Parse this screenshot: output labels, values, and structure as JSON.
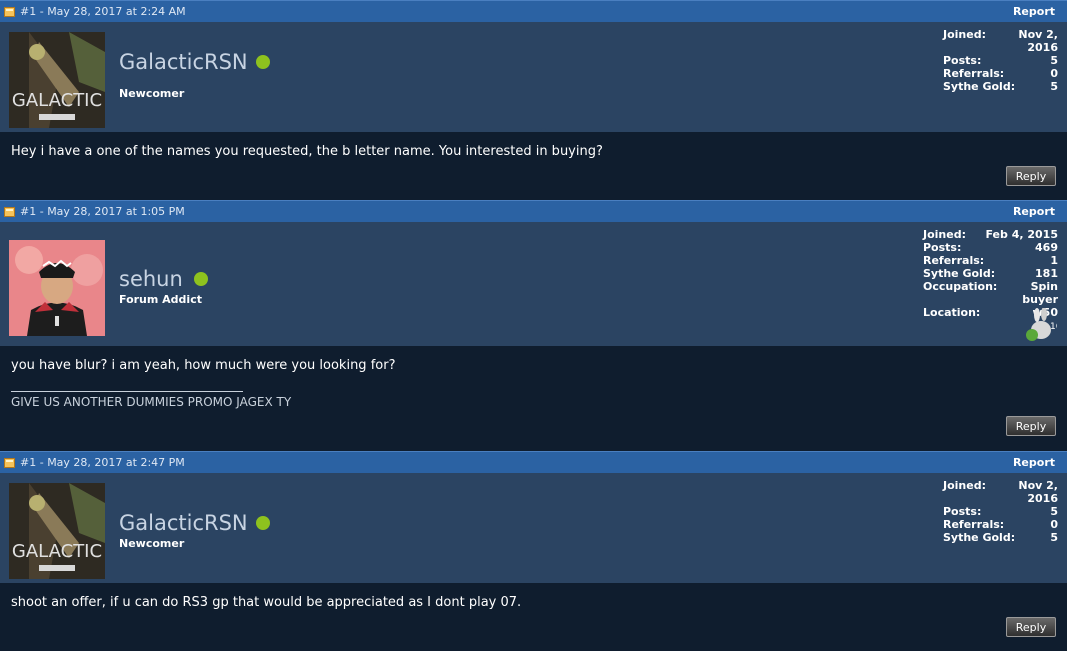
{
  "posts": [
    {
      "number": "#1",
      "date": "May 28, 2017 at 2:24 AM",
      "report": "Report",
      "username": "GalacticRSN",
      "user_title": "Newcomer",
      "avatar_text": "GALACTIC",
      "stats": [
        {
          "label": "Joined:",
          "value": "Nov 2, 2016"
        },
        {
          "label": "Posts:",
          "value": "5"
        },
        {
          "label": "Referrals:",
          "value": "0"
        },
        {
          "label": "Sythe Gold:",
          "value": "5"
        }
      ],
      "message": "Hey i have a one of the names you requested, the b letter name. You interested in buying?",
      "reply": "Reply"
    },
    {
      "number": "#1",
      "date": "May 28, 2017 at 1:05 PM",
      "report": "Report",
      "username": "sehun",
      "user_title": "Forum Addict",
      "stats": [
        {
          "label": "Joined:",
          "value": "Feb 4, 2015"
        },
        {
          "label": "Posts:",
          "value": "469"
        },
        {
          "label": "Referrals:",
          "value": "1"
        },
        {
          "label": "Sythe Gold:",
          "value": "181"
        },
        {
          "label": "Occupation:",
          "value": "Spin buyer"
        },
        {
          "label": "Location:",
          "value": "w50"
        }
      ],
      "badge_number": "16",
      "message": "you have blur? i am yeah, how much were you looking for?",
      "signature": "GIVE US ANOTHER DUMMIES PROMO JAGEX TY",
      "reply": "Reply"
    },
    {
      "number": "#1",
      "date": "May 28, 2017 at 2:47 PM",
      "report": "Report",
      "username": "GalacticRSN",
      "user_title": "Newcomer",
      "avatar_text": "GALACTIC",
      "stats": [
        {
          "label": "Joined:",
          "value": "Nov 2, 2016"
        },
        {
          "label": "Posts:",
          "value": "5"
        },
        {
          "label": "Referrals:",
          "value": "0"
        },
        {
          "label": "Sythe Gold:",
          "value": "5"
        }
      ],
      "message": "shoot an offer, if u can do RS3 gp that would be appreciated as I dont play 07.",
      "reply": "Reply"
    }
  ],
  "colors": {
    "header_bar": "#2b62a3",
    "user_bar": "#2b4462",
    "body": "#0f1d2e",
    "online": "#8ec21e"
  }
}
